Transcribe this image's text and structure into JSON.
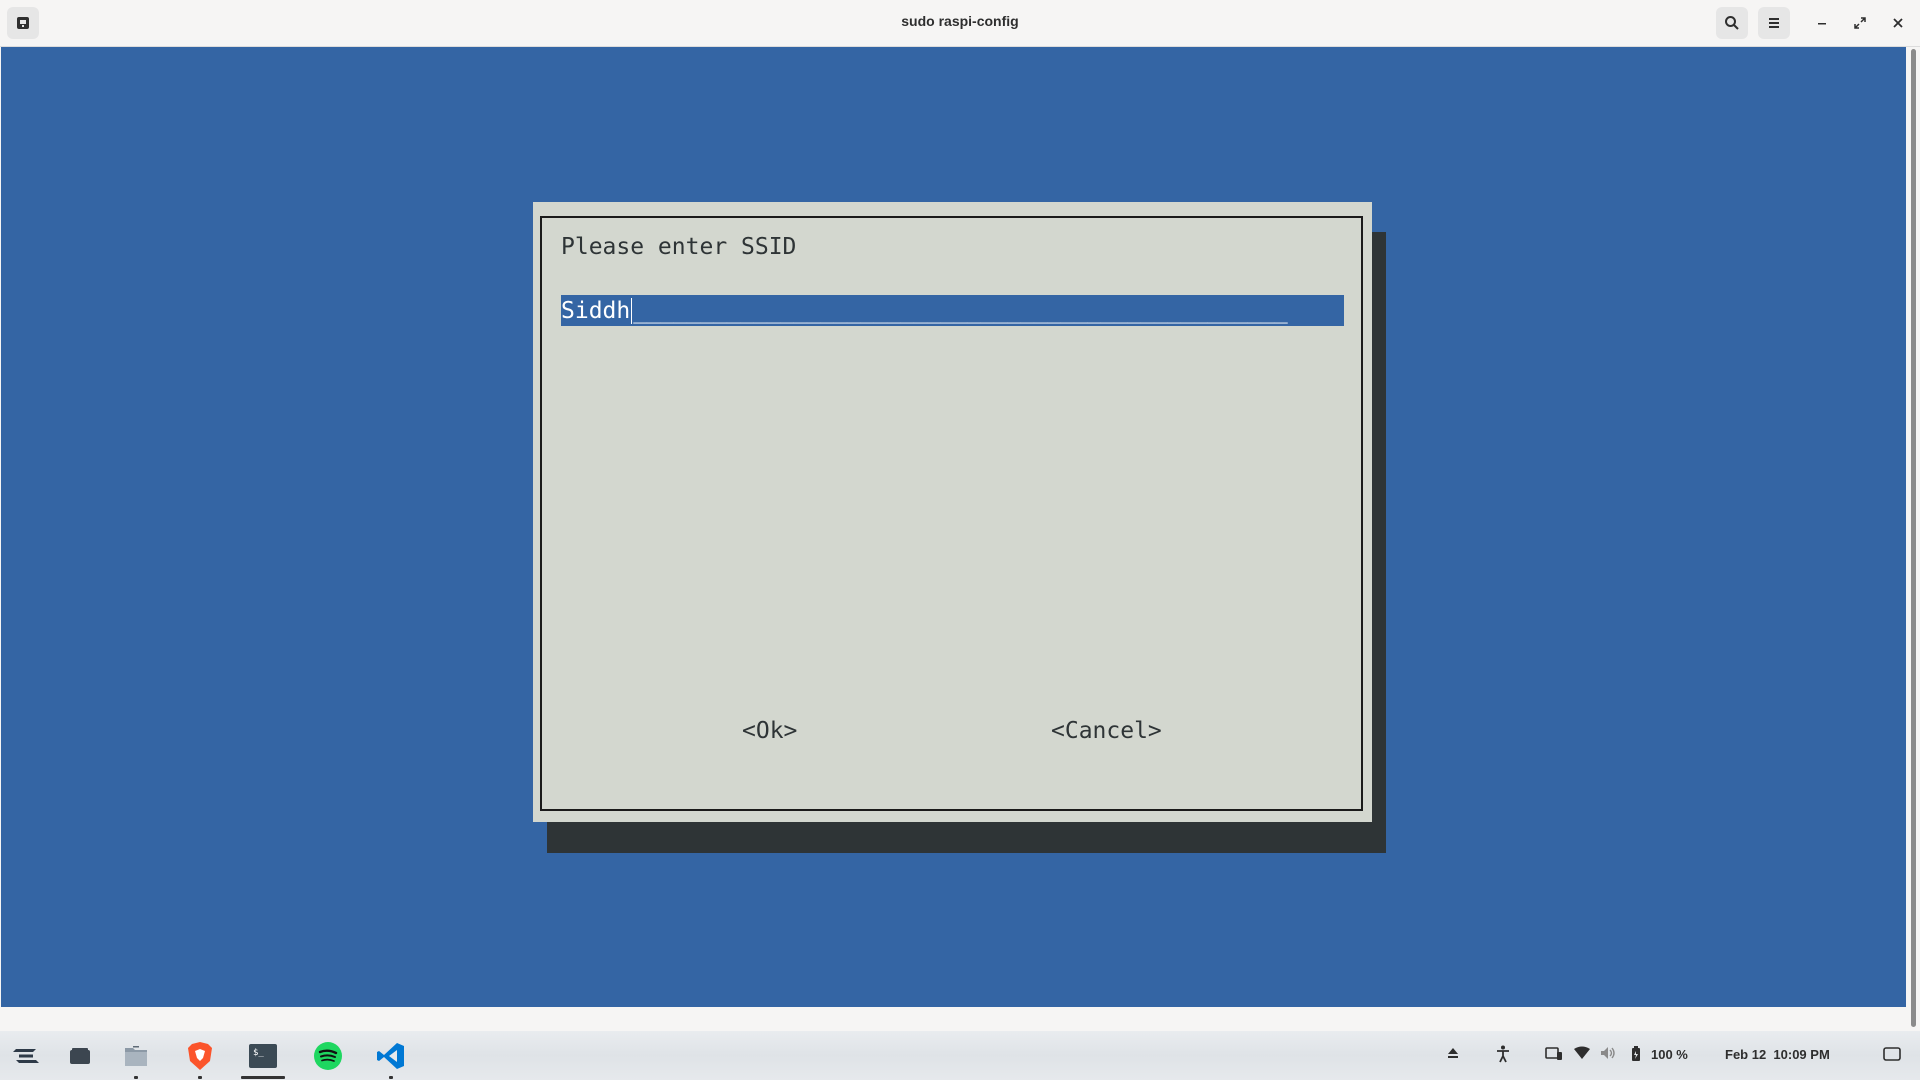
{
  "window": {
    "title": "sudo raspi-config"
  },
  "dialog": {
    "prompt": "Please enter SSID",
    "ssid_value": "Siddh",
    "ssid_fill": "_________________________________________________",
    "ok_label": "<Ok>",
    "cancel_label": "<Cancel>"
  },
  "taskbar": {
    "apps": [
      "zorin-menu-icon",
      "desktop-icon",
      "files-icon",
      "brave-icon",
      "terminal-icon",
      "spotify-icon",
      "vscode-icon"
    ],
    "battery": "100 %",
    "datetime": "Feb 12  10:09 PM"
  },
  "colors": {
    "terminal_bg": "#3465a4",
    "dialog_bg": "#d3d7cf",
    "shadow": "#2e3436"
  }
}
